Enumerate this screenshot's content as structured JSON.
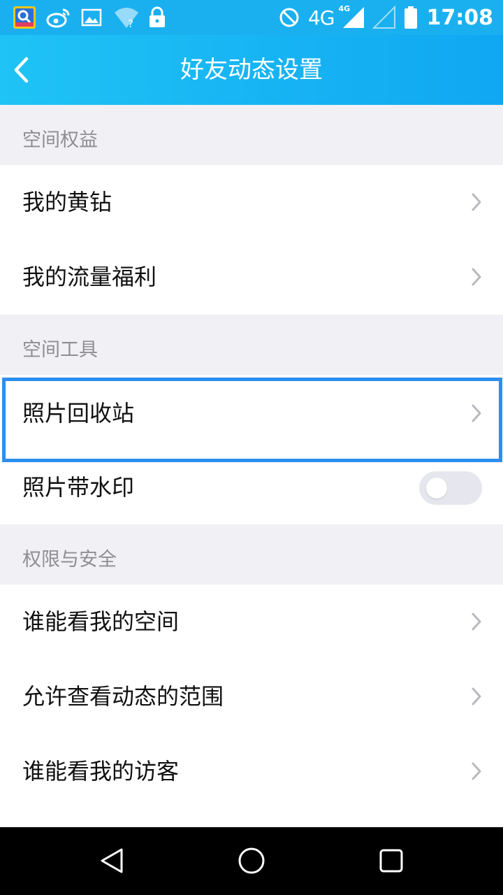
{
  "status_bar": {
    "network": "4G",
    "network_small": "4G",
    "time": "17:08",
    "icons": [
      "app-icon",
      "weibo-icon",
      "gallery-icon",
      "wifi-unknown-icon",
      "lock-icon",
      "do-not-disturb-icon",
      "signal-icon",
      "signal-empty-icon",
      "battery-icon"
    ]
  },
  "app_bar": {
    "title": "好友动态设置",
    "back_icon": "back-arrow-icon"
  },
  "sections": [
    {
      "header": "空间权益",
      "items": [
        {
          "label": "我的黄钻",
          "control": "chevron"
        },
        {
          "label": "我的流量福利",
          "control": "chevron"
        }
      ]
    },
    {
      "header": "空间工具",
      "items": [
        {
          "label": "照片回收站",
          "control": "chevron",
          "highlighted": true
        },
        {
          "label": "照片带水印",
          "control": "toggle",
          "value": false
        }
      ]
    },
    {
      "header": "权限与安全",
      "items": [
        {
          "label": "谁能看我的空间",
          "control": "chevron"
        },
        {
          "label": "允许查看动态的范围",
          "control": "chevron"
        },
        {
          "label": "谁能看我的访客",
          "control": "chevron"
        }
      ]
    }
  ],
  "nav_bar": {
    "buttons": [
      "back-triangle-icon",
      "home-circle-icon",
      "recents-square-icon"
    ]
  },
  "colors": {
    "app_bar": "#10a7f2",
    "highlight": "#2b8ff0",
    "background": "#f0f0f5"
  }
}
